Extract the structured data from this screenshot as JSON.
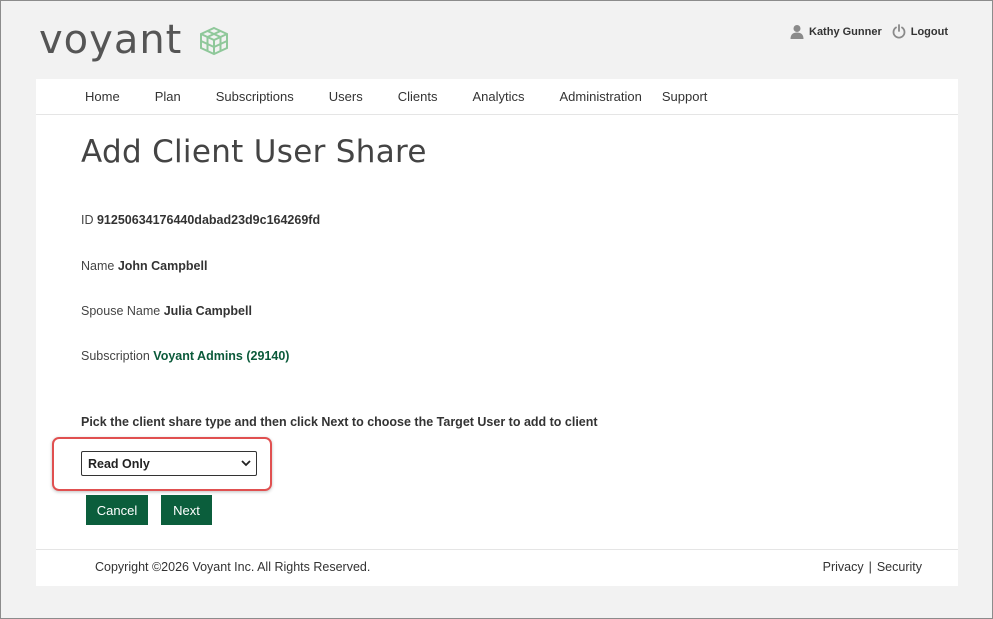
{
  "brand": {
    "name": "voyant",
    "accent_color": "#0b5e3c",
    "logo_mark_color": "#8fc89a"
  },
  "user": {
    "name": "Kathy Gunner",
    "logout_label": "Logout"
  },
  "nav": {
    "items": [
      "Home",
      "Plan",
      "Subscriptions",
      "Users",
      "Clients",
      "Analytics",
      "Administration",
      "Support"
    ]
  },
  "page": {
    "title": "Add Client User Share"
  },
  "fields": {
    "id_label": "ID",
    "id_value": "91250634176440dabad23d9c164269fd",
    "name_label": "Name",
    "name_value": "John Campbell",
    "spouse_label": "Spouse Name",
    "spouse_value": "Julia Campbell",
    "subscription_label": "Subscription",
    "subscription_value": "Voyant Admins (29140)"
  },
  "share": {
    "instruction": "Pick the client share type and then click Next to choose the Target User to add to client",
    "selected_type": "Read Only"
  },
  "buttons": {
    "cancel": "Cancel",
    "next": "Next"
  },
  "footer": {
    "copyright": "Copyright ©2026 Voyant Inc. All Rights Reserved.",
    "privacy": "Privacy",
    "separator": "|",
    "security": "Security"
  }
}
